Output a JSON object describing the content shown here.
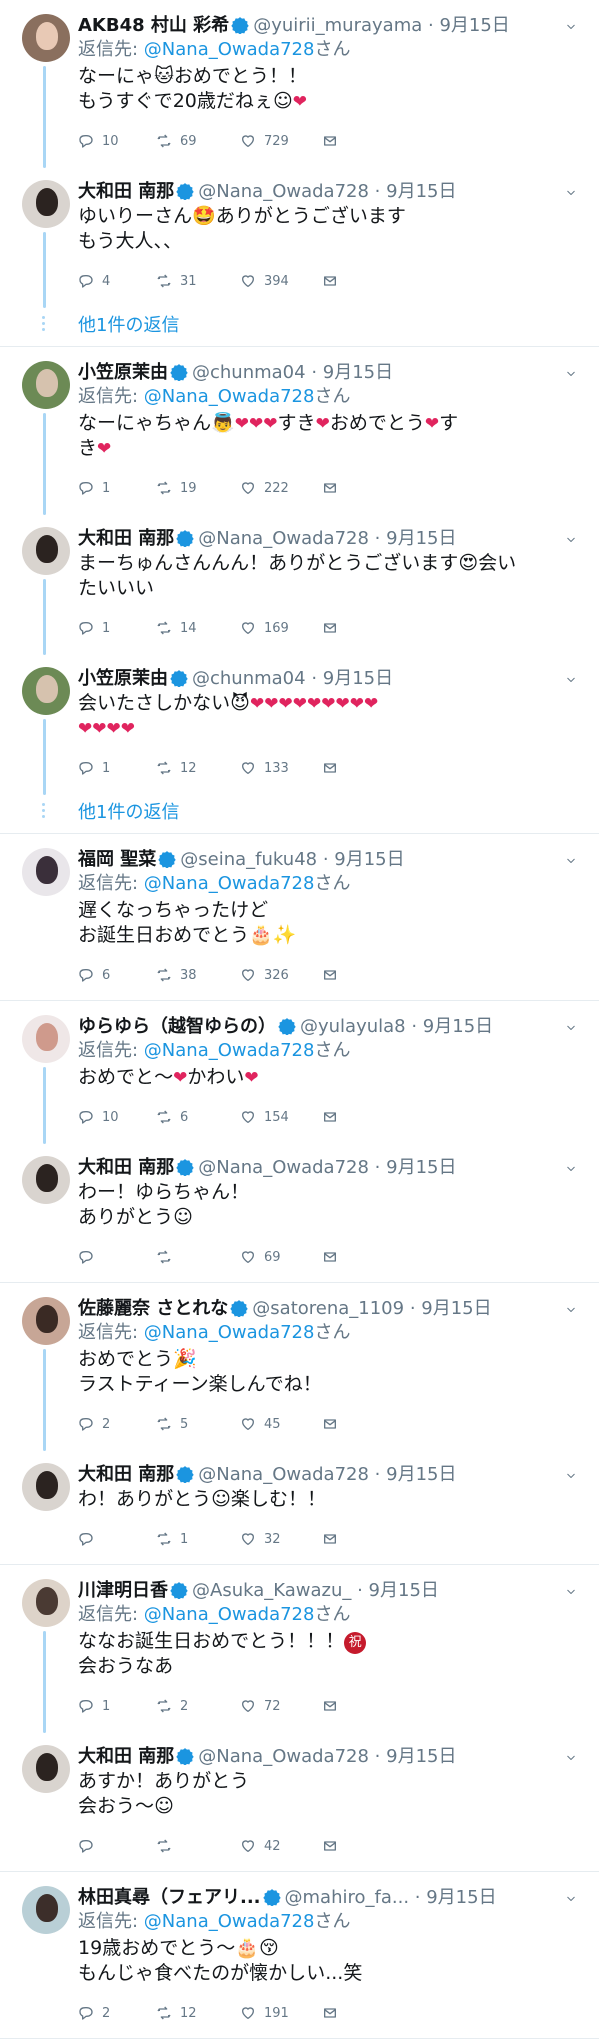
{
  "colors": {
    "link": "#1b95e0",
    "muted": "#657786",
    "heart": "#e0245e",
    "rail": "#a9d6f5",
    "divider": "#e6ecf0"
  },
  "threads": [
    {
      "tweets": [
        {
          "name": "AKB48 村山 彩希",
          "handle": "@yuirii_murayama",
          "time": "· 9月15日",
          "replyto_prefix": "返信先:",
          "replyto_link": "@Nana_Owada728",
          "replyto_suffix": "さん",
          "lines": [
            "なーにゃ🐱おめでとう！！",
            "もうすぐで20歳だねぇ☺️❤️"
          ],
          "reply": "10",
          "retweet": "69",
          "like": "729",
          "avatar": [
            "#8a6f5e",
            "#e8c9b5"
          ]
        },
        {
          "name": "大和田 南那",
          "handle": "@Nana_Owada728",
          "time": "· 9月15日",
          "lines": [
            "ゆいりーさん🤩ありがとうございます",
            "もう大人、、"
          ],
          "reply": "4",
          "retweet": "31",
          "like": "394",
          "avatar": [
            "#d9d4cf",
            "#2b2320"
          ]
        }
      ],
      "more": "他1件の返信"
    },
    {
      "tweets": [
        {
          "name": "小笠原茉由",
          "handle": "@chunma04",
          "time": "· 9月15日",
          "replyto_prefix": "返信先:",
          "replyto_link": "@Nana_Owada728",
          "replyto_suffix": "さん",
          "lines": [
            "なーにゃちゃん👼❤️❤️❤️すき❤️おめでとう❤️す",
            "き❤️"
          ],
          "reply": "1",
          "retweet": "19",
          "like": "222",
          "avatar": [
            "#6c8a55",
            "#d6c2ae"
          ]
        },
        {
          "name": "大和田 南那",
          "handle": "@Nana_Owada728",
          "time": "· 9月15日",
          "lines": [
            "まーちゅんさんんん！ありがとうございます😍会い",
            "たいいい"
          ],
          "reply": "1",
          "retweet": "14",
          "like": "169",
          "avatar": [
            "#d9d4cf",
            "#2b2320"
          ]
        },
        {
          "name": "小笠原茉由",
          "handle": "@chunma04",
          "time": "· 9月15日",
          "lines": [
            "会いたさしかない😈❤️❤️❤️❤️❤️❤️❤️❤️❤️",
            "❤️❤️❤️❤️"
          ],
          "reply": "1",
          "retweet": "12",
          "like": "133",
          "avatar": [
            "#6c8a55",
            "#d6c2ae"
          ]
        }
      ],
      "more": "他1件の返信"
    },
    {
      "tweets": [
        {
          "name": "福岡 聖菜",
          "handle": "@seina_fuku48",
          "time": "· 9月15日",
          "replyto_prefix": "返信先:",
          "replyto_link": "@Nana_Owada728",
          "replyto_suffix": "さん",
          "lines": [
            "遅くなっちゃったけど",
            "お誕生日おめでとう🎂✨"
          ],
          "reply": "6",
          "retweet": "38",
          "like": "326",
          "avatar": [
            "#e9e6ea",
            "#3a2f3a"
          ]
        }
      ]
    },
    {
      "tweets": [
        {
          "name": "ゆらゆら（越智ゆらの）",
          "handle": "@yulayula8",
          "time": "· 9月15日",
          "replyto_prefix": "返信先:",
          "replyto_link": "@Nana_Owada728",
          "replyto_suffix": "さん",
          "lines": [
            "おめでと〜❤️かわい❤️"
          ],
          "reply": "10",
          "retweet": "6",
          "like": "154",
          "avatar": [
            "#efe7e7",
            "#cf9a8c"
          ]
        },
        {
          "name": "大和田 南那",
          "handle": "@Nana_Owada728",
          "time": "· 9月15日",
          "lines": [
            "わー！ゆらちゃん！",
            "ありがとう☺️"
          ],
          "reply": "",
          "retweet": "",
          "like": "69",
          "avatar": [
            "#d9d4cf",
            "#2b2320"
          ]
        }
      ]
    },
    {
      "tweets": [
        {
          "name": "佐藤麗奈 さとれな",
          "handle": "@satorena_1109",
          "time": "· 9月15日",
          "replyto_prefix": "返信先:",
          "replyto_link": "@Nana_Owada728",
          "replyto_suffix": "さん",
          "lines": [
            "おめでとう🎉",
            "ラストティーン楽しんでね！"
          ],
          "reply": "2",
          "retweet": "5",
          "like": "45",
          "avatar": [
            "#c7a696",
            "#3a2a24"
          ]
        },
        {
          "name": "大和田 南那",
          "handle": "@Nana_Owada728",
          "time": "· 9月15日",
          "lines": [
            "わ！ありがとう☺️楽しむ！！"
          ],
          "reply": "",
          "retweet": "1",
          "like": "32",
          "avatar": [
            "#d9d4cf",
            "#2b2320"
          ]
        }
      ]
    },
    {
      "tweets": [
        {
          "name": "川津明日香",
          "handle": "@Asuka_Kawazu_",
          "time": "· 9月15日",
          "replyto_prefix": "返信先:",
          "replyto_link": "@Nana_Owada728",
          "replyto_suffix": "さん",
          "lines": [
            "ななお誕生日おめでとう！！！㊗",
            "会おうなあ"
          ],
          "reply": "1",
          "retweet": "2",
          "like": "72",
          "avatar": [
            "#ddd3c9",
            "#4a3a33"
          ]
        },
        {
          "name": "大和田 南那",
          "handle": "@Nana_Owada728",
          "time": "· 9月15日",
          "lines": [
            "あすか！ありがとう",
            "会おう〜☺️"
          ],
          "reply": "",
          "retweet": "",
          "like": "42",
          "avatar": [
            "#d9d4cf",
            "#2b2320"
          ]
        }
      ]
    },
    {
      "tweets": [
        {
          "name": "林田真尋（フェアリ...",
          "handle": "@mahiro_fa...",
          "time": "· 9月15日",
          "replyto_prefix": "返信先:",
          "replyto_link": "@Nana_Owada728",
          "replyto_suffix": "さん",
          "lines": [
            "19歳おめでとう〜🎂😚",
            "もんじゃ食べたのが懐かしい...笑"
          ],
          "reply": "2",
          "retweet": "12",
          "like": "191",
          "avatar": [
            "#b9cfd6",
            "#3c2e2a"
          ]
        }
      ]
    }
  ]
}
